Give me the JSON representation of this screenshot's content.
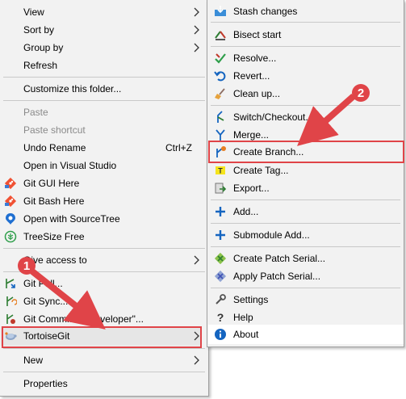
{
  "main_menu": {
    "view": "View",
    "sort_by": "Sort by",
    "group_by": "Group by",
    "refresh": "Refresh",
    "customize": "Customize this folder...",
    "paste": "Paste",
    "paste_shortcut": "Paste shortcut",
    "undo_rename": "Undo Rename",
    "undo_shortcut": "Ctrl+Z",
    "open_vs": "Open in Visual Studio",
    "git_gui": "Git GUI Here",
    "git_bash": "Git Bash Here",
    "sourcetree": "Open with SourceTree",
    "treesize": "TreeSize Free",
    "give_access": "Give access to",
    "git_pull": "Git Pull...",
    "git_sync": "Git Sync...",
    "git_commit": "Git Commit -> \"developer\"...",
    "tortoisegit": "TortoiseGit",
    "new": "New",
    "properties": "Properties"
  },
  "sub_menu": {
    "stash": "Stash changes",
    "bisect": "Bisect start",
    "resolve": "Resolve...",
    "revert": "Revert...",
    "cleanup": "Clean up...",
    "switch": "Switch/Checkout...",
    "merge": "Merge...",
    "create_branch": "Create Branch...",
    "create_tag": "Create Tag...",
    "export": "Export...",
    "add": "Add...",
    "submodule_add": "Submodule Add...",
    "create_patch": "Create Patch Serial...",
    "apply_patch": "Apply Patch Serial...",
    "settings": "Settings",
    "help": "Help",
    "about": "About"
  },
  "annotations": {
    "badge1": "1",
    "badge2": "2"
  },
  "colors": {
    "annotation_red": "#e04448",
    "menu_bg": "#f2f2f2",
    "hover_bg": "#e6e6e6"
  }
}
